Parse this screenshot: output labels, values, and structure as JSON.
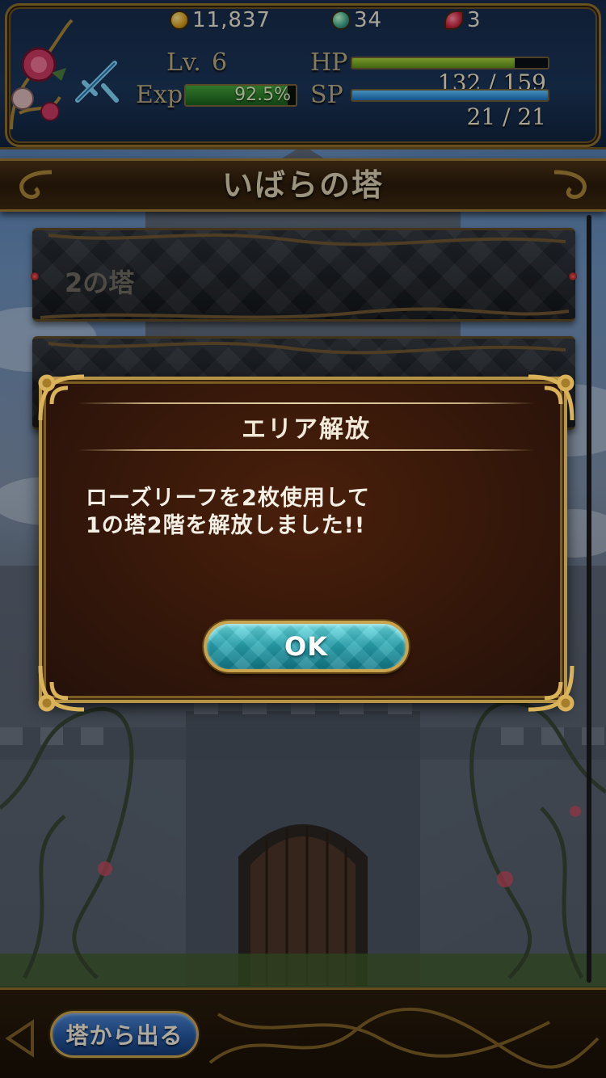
{
  "status": {
    "coins": "11,837",
    "orbs": "34",
    "rose_leaves": "3",
    "level_label": "Lv.",
    "level_value": "6",
    "exp_label": "Exp",
    "exp_percent_text": "92.5%",
    "exp_fraction": 0.925,
    "hp_label": "HP",
    "hp_value": "132 / 159",
    "hp_fraction": 0.83,
    "sp_label": "SP",
    "sp_value": "21 / 21",
    "sp_fraction": 1.0
  },
  "header": {
    "title": "いばらの塔"
  },
  "floors": [
    {
      "label": "2の塔"
    },
    {
      "label": ""
    }
  ],
  "dialog": {
    "title": "エリア解放",
    "message_line1": "ローズリーフを2枚使用して",
    "message_line2": "1の塔2階を解放しました!!",
    "ok_label": "OK"
  },
  "footer": {
    "exit_label": "塔から出る"
  },
  "colors": {
    "gold_frame": "#b89446",
    "dialog_bg": "#3a180b",
    "ok_teal": "#2aa7b3",
    "exit_blue": "#24569e",
    "hp_green": "#7fb52a",
    "sp_blue": "#2f95e0"
  }
}
